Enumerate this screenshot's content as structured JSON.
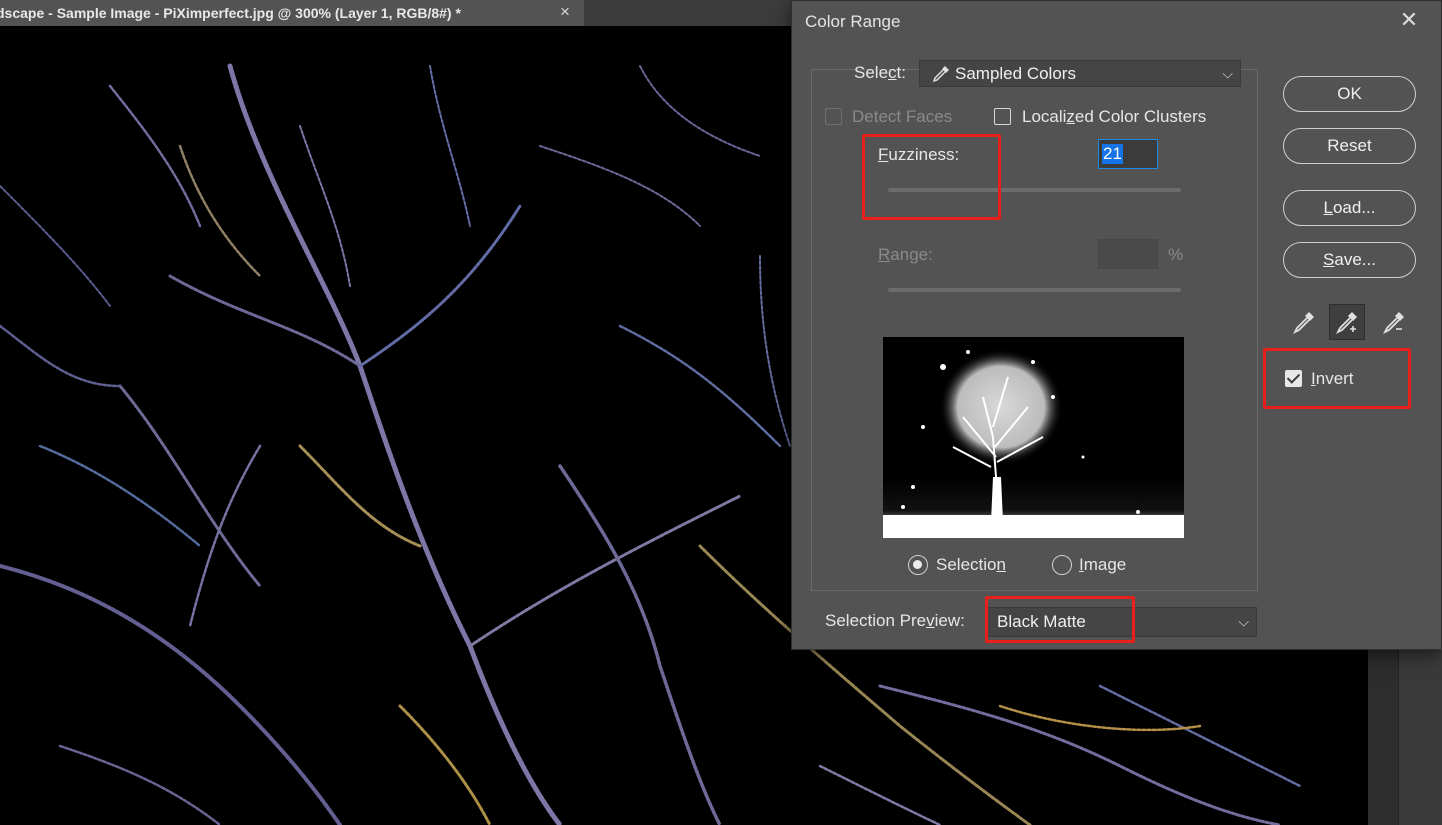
{
  "document": {
    "tab_title": "dscape - Sample Image - PiXimperfect.jpg @ 300% (Layer 1, RGB/8#) *",
    "tab_close": "×"
  },
  "dialog": {
    "title": "Color Range",
    "close": "✕",
    "select": {
      "label_pre": "Sele",
      "label_u": "c",
      "label_post": "t:",
      "value": "Sampled Colors",
      "icon": "eyedropper-icon"
    },
    "detect_faces": {
      "label": "Detect Faces",
      "checked": false,
      "enabled": false
    },
    "localized_clusters": {
      "label_pre": "Locali",
      "label_u": "z",
      "label_post": "ed Color Clusters",
      "checked": false
    },
    "fuzziness": {
      "label_u": "F",
      "label_post": "uzziness:",
      "value": "21",
      "slider_fraction": 0.105
    },
    "range": {
      "label_u": "R",
      "label_post": "ange:",
      "value": "",
      "unit": "%",
      "enabled": false
    },
    "preview_mode": {
      "selection": {
        "label_pre": "Selectio",
        "label_u": "n",
        "checked": true
      },
      "image": {
        "label_u": "I",
        "label_post": "mage",
        "checked": false
      }
    },
    "selection_preview": {
      "label_pre": "Selection Pre",
      "label_u": "v",
      "label_post": "iew:",
      "value": "Black Matte"
    },
    "buttons": {
      "ok": "OK",
      "reset": "Reset",
      "load_u": "L",
      "load_post": "oad...",
      "save_u": "S",
      "save_post": "ave..."
    },
    "eyedroppers": [
      "eyedropper-icon",
      "eyedropper-plus-icon",
      "eyedropper-minus-icon"
    ],
    "invert": {
      "label_u": "I",
      "label_post": "nvert",
      "checked": true
    }
  },
  "colors": {
    "dialog_bg": "#535353",
    "highlight": "#e8201a",
    "focus": "#1473e6"
  }
}
